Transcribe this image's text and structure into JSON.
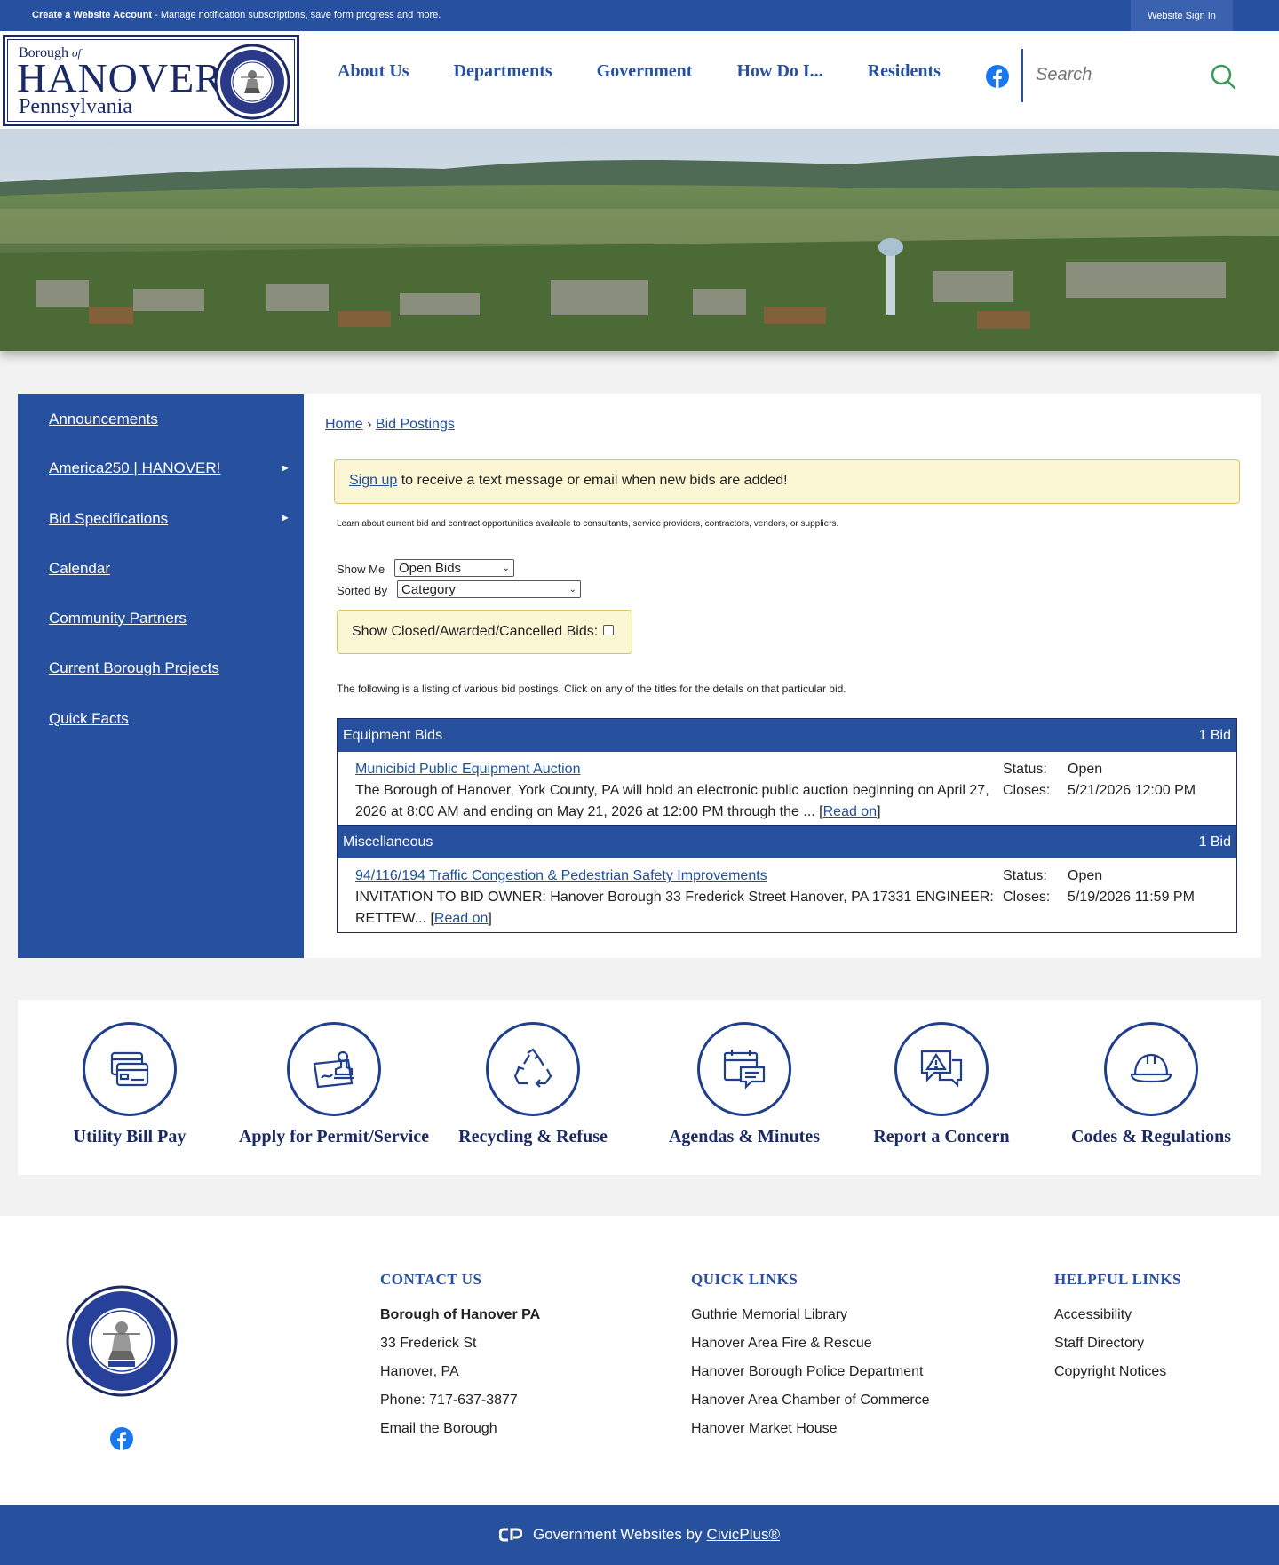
{
  "topbar": {
    "create_account_label": "Create a Website Account",
    "create_account_desc": " - Manage notification subscriptions, save form progress and more.",
    "signin_label": "Website Sign In"
  },
  "logo": {
    "line1": "Borough",
    "of": "of",
    "line2": "HANOVER",
    "line3": "Pennsylvania"
  },
  "nav": {
    "items": [
      "About Us",
      "Departments",
      "Government",
      "How Do I...",
      "Residents"
    ]
  },
  "search": {
    "placeholder": "Search"
  },
  "sidebar": {
    "items": [
      {
        "label": "Announcements",
        "has_arrow": false
      },
      {
        "label": "America250 | HANOVER!",
        "has_arrow": true
      },
      {
        "label": "Bid Specifications",
        "has_arrow": true
      },
      {
        "label": "Calendar",
        "has_arrow": false
      },
      {
        "label": "Community Partners",
        "has_arrow": false
      },
      {
        "label": "Current Borough Projects",
        "has_arrow": false
      },
      {
        "label": "Quick Facts",
        "has_arrow": false
      }
    ]
  },
  "breadcrumb": {
    "home": "Home",
    "sep": " › ",
    "current": "Bid Postings"
  },
  "notice": {
    "link": "Sign up",
    "text": " to receive a text message or email when new bids are added!"
  },
  "intro": "Learn about current bid and contract opportunities available to consultants, service providers, contractors, vendors, or suppliers.",
  "filters": {
    "show_me_label": "Show Me",
    "show_me_value": "Open Bids",
    "sorted_by_label": "Sorted By",
    "sorted_by_value": "Category",
    "closed_label": "Show Closed/Awarded/Cancelled Bids:"
  },
  "listing_note": "The following is a listing of various bid postings. Click on any of the titles for the details on that particular bid.",
  "bid_categories": [
    {
      "name": "Equipment Bids",
      "count": "1 Bid",
      "bid": {
        "title": "Municibid Public Equipment Auction",
        "desc": "The Borough of Hanover, York County, PA will hold an electronic public auction beginning on April 27, 2026 at 8:00 AM and ending on May 21, 2026 at 12:00 PM through the ... ",
        "read_on": "Read on",
        "status_label": "Status:",
        "status": "Open",
        "closes_label": "Closes:",
        "closes": "5/21/2026 12:00 PM"
      }
    },
    {
      "name": "Miscellaneous",
      "count": "1 Bid",
      "bid": {
        "title": "94/116/194 Traffic Congestion & Pedestrian Safety Improvements",
        "desc": "INVITATION TO BID OWNER: Hanover Borough 33 Frederick Street Hanover, PA 17331 ENGINEER: RETTEW... ",
        "read_on": "Read on",
        "status_label": "Status:",
        "status": "Open",
        "closes_label": "Closes:",
        "closes": "5/19/2026 11:59 PM"
      }
    }
  ],
  "quick_links": [
    {
      "label": "Utility Bill Pay",
      "icon": "credit-card-icon"
    },
    {
      "label": "Apply for Permit/Service",
      "icon": "stamp-icon"
    },
    {
      "label": "Recycling & Refuse",
      "icon": "recycle-icon"
    },
    {
      "label": "Agendas & Minutes",
      "icon": "calendar-chat-icon"
    },
    {
      "label": "Report a Concern",
      "icon": "warning-chat-icon"
    },
    {
      "label": "Codes & Regulations",
      "icon": "hard-hat-icon"
    }
  ],
  "footer": {
    "contact": {
      "title": "CONTACT US",
      "name": "Borough of Hanover PA",
      "address1": "33 Frederick St",
      "address2": "Hanover, PA",
      "phone": "Phone: 717-637-3877",
      "email": "Email the Borough"
    },
    "quick_links": {
      "title": "QUICK LINKS",
      "items": [
        "Guthrie Memorial Library",
        "Hanover Area Fire & Rescue",
        "Hanover Borough Police Department",
        "Hanover Area Chamber of Commerce",
        "Hanover Market House"
      ]
    },
    "helpful_links": {
      "title": "HELPFUL LINKS",
      "items": [
        "Accessibility",
        "Staff Directory",
        "Copyright Notices"
      ]
    }
  },
  "bottom": {
    "text": "Government Websites by",
    "link": "CivicPlus®"
  },
  "colors": {
    "brand_blue": "#27509e",
    "navy": "#1b2a64",
    "notice_bg": "#fbf6d3"
  }
}
